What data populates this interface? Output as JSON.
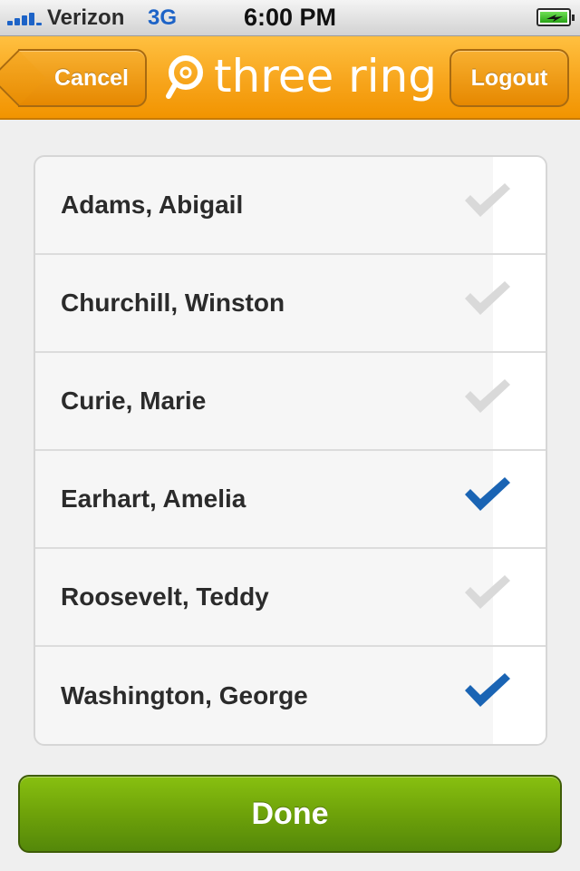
{
  "status_bar": {
    "carrier": "Verizon",
    "network": "3G",
    "time": "6:00 PM"
  },
  "header": {
    "cancel_label": "Cancel",
    "logout_label": "Logout",
    "logo_text": "three ring"
  },
  "people": [
    {
      "name": "Adams, Abigail",
      "checked": false
    },
    {
      "name": "Churchill, Winston",
      "checked": false
    },
    {
      "name": "Curie, Marie",
      "checked": false
    },
    {
      "name": "Earhart, Amelia",
      "checked": true
    },
    {
      "name": "Roosevelt, Teddy",
      "checked": false
    },
    {
      "name": "Washington, George",
      "checked": true
    }
  ],
  "done_label": "Done",
  "colors": {
    "checked": "#1a64b4",
    "unchecked": "#d9d9d9"
  }
}
